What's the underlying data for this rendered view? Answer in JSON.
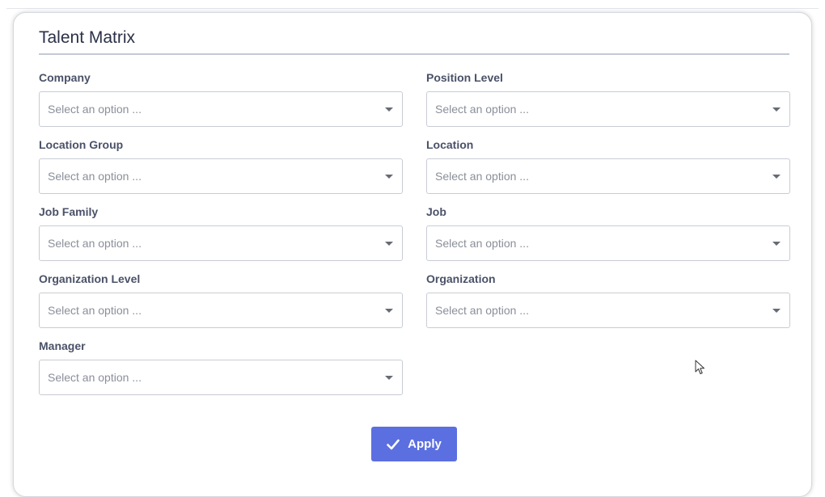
{
  "card": {
    "title": "Talent Matrix"
  },
  "filters": [
    {
      "id": "company",
      "label": "Company",
      "placeholder": "Select an option ..."
    },
    {
      "id": "position-level",
      "label": "Position Level",
      "placeholder": "Select an option ..."
    },
    {
      "id": "location-group",
      "label": "Location Group",
      "placeholder": "Select an option ..."
    },
    {
      "id": "location",
      "label": "Location",
      "placeholder": "Select an option ..."
    },
    {
      "id": "job-family",
      "label": "Job Family",
      "placeholder": "Select an option ..."
    },
    {
      "id": "job",
      "label": "Job",
      "placeholder": "Select an option ..."
    },
    {
      "id": "organization-level",
      "label": "Organization Level",
      "placeholder": "Select an option ..."
    },
    {
      "id": "organization",
      "label": "Organization",
      "placeholder": "Select an option ..."
    },
    {
      "id": "manager",
      "label": "Manager",
      "placeholder": "Select an option ..."
    }
  ],
  "actions": {
    "apply_label": "Apply"
  },
  "colors": {
    "accent": "#5c6fe0",
    "title": "#2b3046",
    "label": "#4a5168",
    "placeholder": "#8a8f99",
    "border": "#c8ccd4"
  },
  "icons": {
    "dropdown": "caret-down-icon",
    "apply": "check-icon",
    "pointer": "mouse-cursor-icon"
  }
}
